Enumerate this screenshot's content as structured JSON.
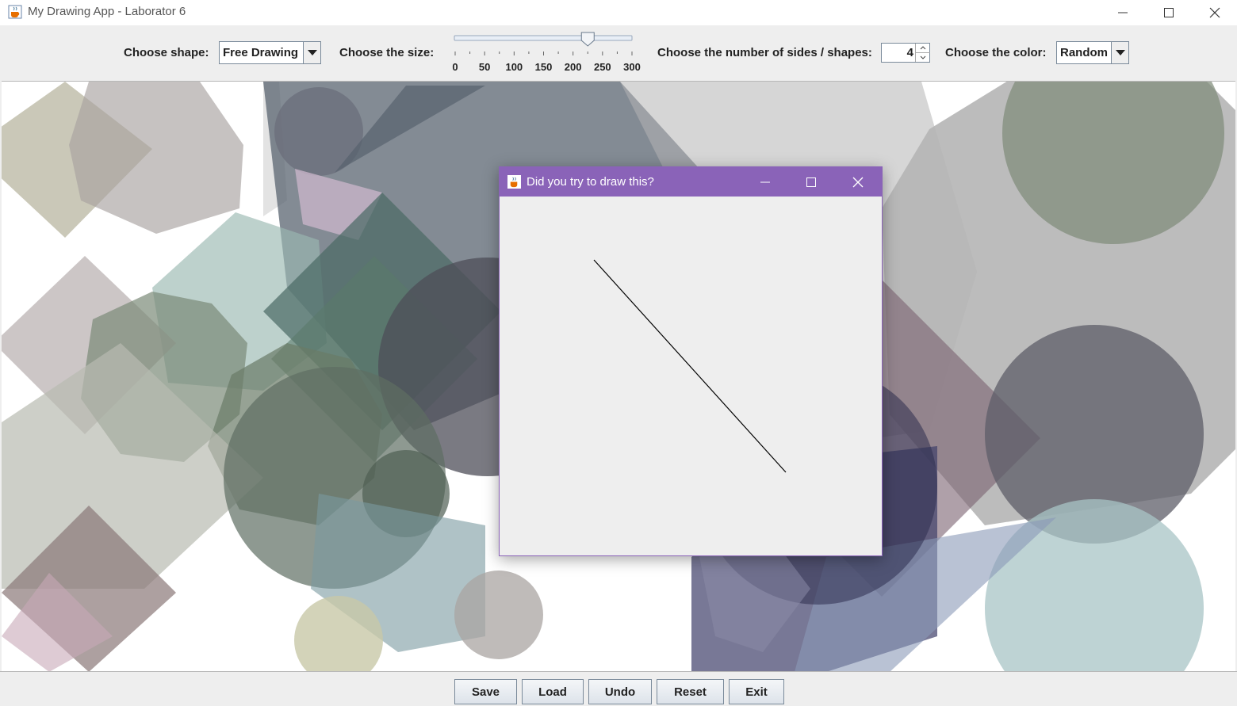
{
  "window": {
    "title": "My Drawing App - Laborator 6"
  },
  "toolbar": {
    "shape_label": "Choose shape:",
    "shape_value": "Free Drawing",
    "size_label": "Choose the size:",
    "size_ticks": [
      "0",
      "50",
      "100",
      "150",
      "200",
      "250",
      "300"
    ],
    "size_value": 225,
    "size_max": 300,
    "sides_label": "Choose the number of sides / shapes:",
    "sides_value": "4",
    "color_label": "Choose the color:",
    "color_value": "Random"
  },
  "buttons": {
    "save": "Save",
    "load": "Load",
    "undo": "Undo",
    "reset": "Reset",
    "exit": "Exit"
  },
  "dialog": {
    "title": "Did you try to draw this?"
  },
  "icons": {
    "app": "java-cup-icon",
    "minimize": "minimize-icon",
    "maximize": "maximize-icon",
    "close": "close-icon",
    "dropdown": "triangle-down-icon"
  },
  "colors": {
    "dialog_accent": "#8a63b8",
    "panel_bg": "#eeeeee"
  }
}
